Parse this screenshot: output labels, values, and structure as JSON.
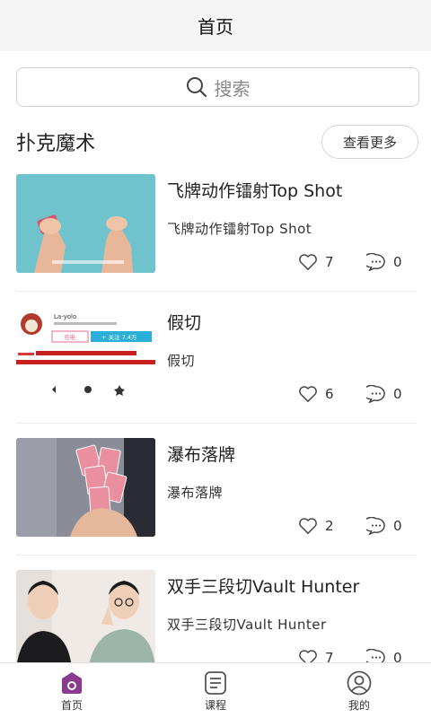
{
  "header": {
    "title": "首页"
  },
  "search": {
    "placeholder": "搜索"
  },
  "section": {
    "title": "扑克魔术",
    "more_label": "查看更多"
  },
  "items": [
    {
      "title": "飞牌动作镭射Top Shot",
      "desc": "飞牌动作镭射Top Shot",
      "likes": "7",
      "comments": "0"
    },
    {
      "title": "假切",
      "desc": "假切",
      "likes": "6",
      "comments": "0",
      "thumb": {
        "username": "La-yolo",
        "follow_count": "7.4万",
        "follow_label": "关注",
        "charge_label": "充电"
      }
    },
    {
      "title": "瀑布落牌",
      "desc": "瀑布落牌",
      "likes": "2",
      "comments": "0"
    },
    {
      "title": "双手三段切Vault Hunter",
      "desc": "双手三段切Vault Hunter",
      "likes": "7",
      "comments": "0"
    }
  ],
  "nav": [
    {
      "label": "首页",
      "icon": "home-icon",
      "active": true
    },
    {
      "label": "课程",
      "icon": "course-icon",
      "active": false
    },
    {
      "label": "我的",
      "icon": "profile-icon",
      "active": false
    }
  ],
  "colors": {
    "accent": "#8b3a8f",
    "topbar_bg": "#f5f5f5",
    "border": "#cfcfcf"
  }
}
